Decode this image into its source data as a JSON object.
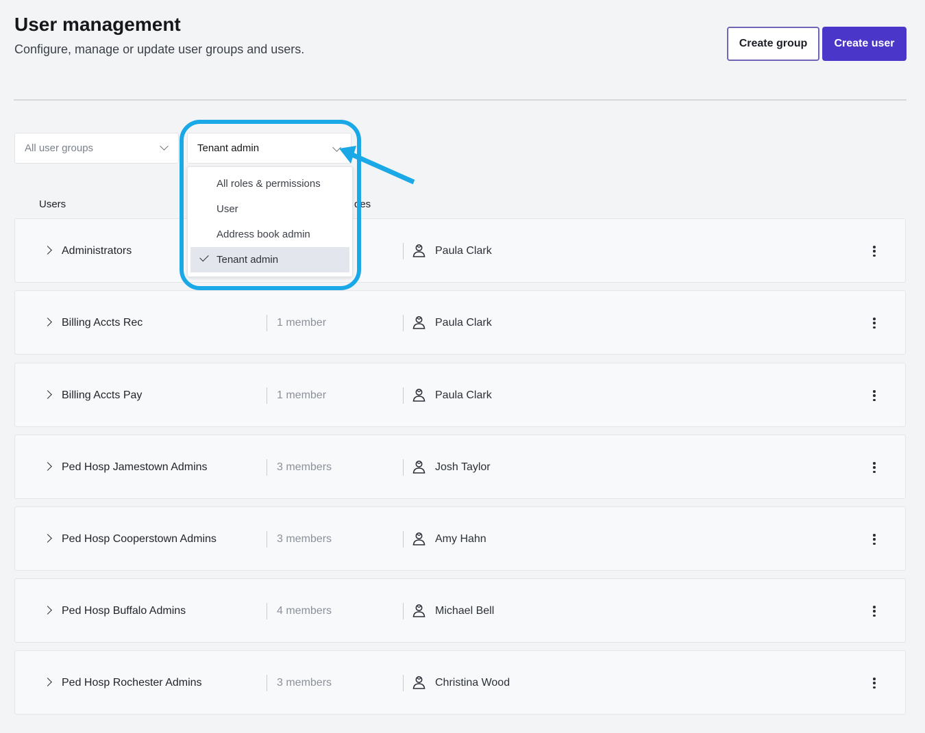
{
  "header": {
    "title": "User management",
    "subtitle": "Configure, manage or update user groups and users.",
    "create_group_label": "Create group",
    "create_user_label": "Create user"
  },
  "filters": {
    "group_filter": {
      "selected": "All user groups"
    },
    "role_filter": {
      "selected": "Tenant admin",
      "options": [
        "All roles & permissions",
        "User",
        "Address book admin",
        "Tenant admin"
      ]
    }
  },
  "table": {
    "columns": [
      "Users",
      "des"
    ],
    "rows": [
      {
        "name": "Administrators",
        "members": "",
        "owner": "Paula Clark"
      },
      {
        "name": "Billing Accts Rec",
        "members": "1 member",
        "owner": "Paula Clark"
      },
      {
        "name": "Billing Accts Pay",
        "members": "1 member",
        "owner": "Paula Clark"
      },
      {
        "name": "Ped Hosp Jamestown Admins",
        "members": "3 members",
        "owner": "Josh Taylor"
      },
      {
        "name": "Ped Hosp Cooperstown Admins",
        "members": "3 members",
        "owner": "Amy Hahn"
      },
      {
        "name": "Ped Hosp Buffalo Admins",
        "members": "4 members",
        "owner": "Michael Bell"
      },
      {
        "name": "Ped Hosp Rochester Admins",
        "members": "3 members",
        "owner": "Christina Wood"
      }
    ]
  },
  "colors": {
    "primary": "#4a36c9",
    "highlight": "#1aa8e6",
    "background": "#f3f4f6"
  },
  "icons": [
    "chevron-down-icon",
    "chevron-right-icon",
    "person-icon",
    "kebab-menu-icon",
    "checkmark-icon"
  ]
}
